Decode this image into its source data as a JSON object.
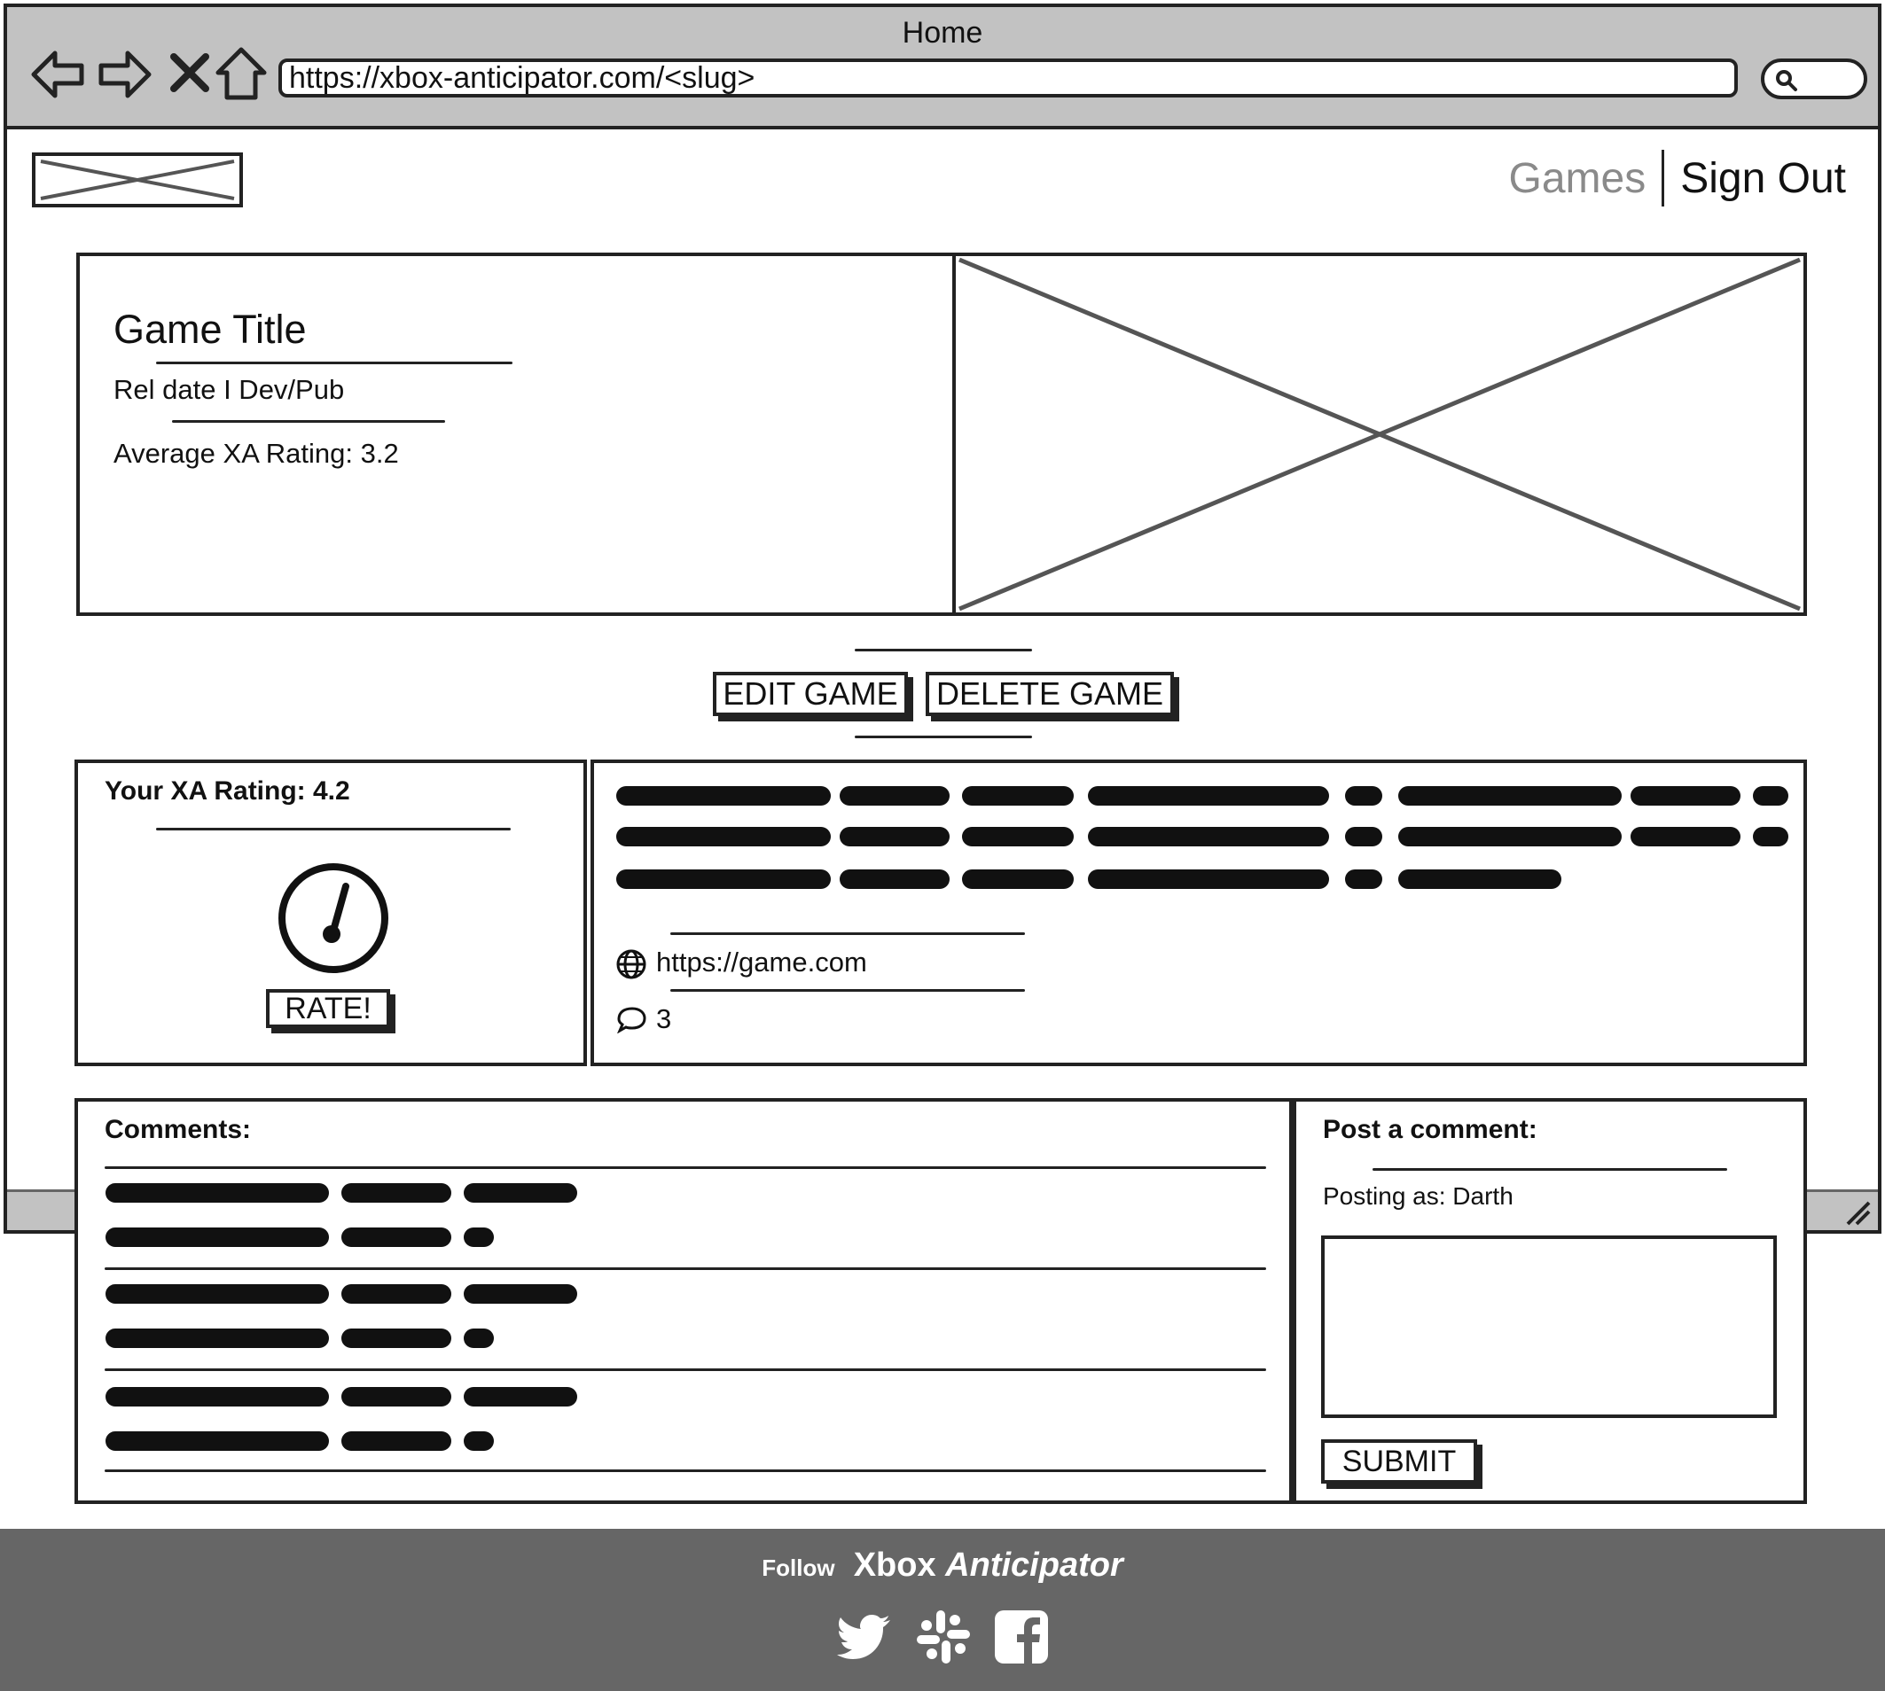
{
  "browser": {
    "window_title": "Home",
    "url": "https://xbox-anticipator.com/<slug>",
    "icons": [
      "back-arrow-icon",
      "forward-arrow-icon",
      "close-x-icon",
      "home-icon",
      "search-icon"
    ]
  },
  "nav": {
    "games": "Games",
    "sign_out": "Sign Out"
  },
  "game": {
    "title": "Game Title",
    "rel": "Rel date I Dev/Pub",
    "avg_rating": "Average XA Rating: 3.2"
  },
  "actions": {
    "edit": "EDIT GAME",
    "delete": "DELETE GAME"
  },
  "user_rating": {
    "label": "Your XA Rating: 4.2",
    "rate_button": "RATE!"
  },
  "details": {
    "website": "https://game.com",
    "comment_count": "3"
  },
  "comments": {
    "heading": "Comments:"
  },
  "post": {
    "heading": "Post a comment:",
    "posting_as": "Posting as: Darth",
    "submit": "SUBMIT"
  },
  "footer": {
    "follow": "Follow",
    "brand_1": "Xbox",
    "brand_2": "Anticipator",
    "social": [
      "twitter-icon",
      "slack-icon",
      "facebook-icon"
    ]
  },
  "colors": {
    "chrome": "#c2c2c2",
    "footer": "#666666",
    "muted_link": "#8a8a8a",
    "ink": "#222222"
  }
}
